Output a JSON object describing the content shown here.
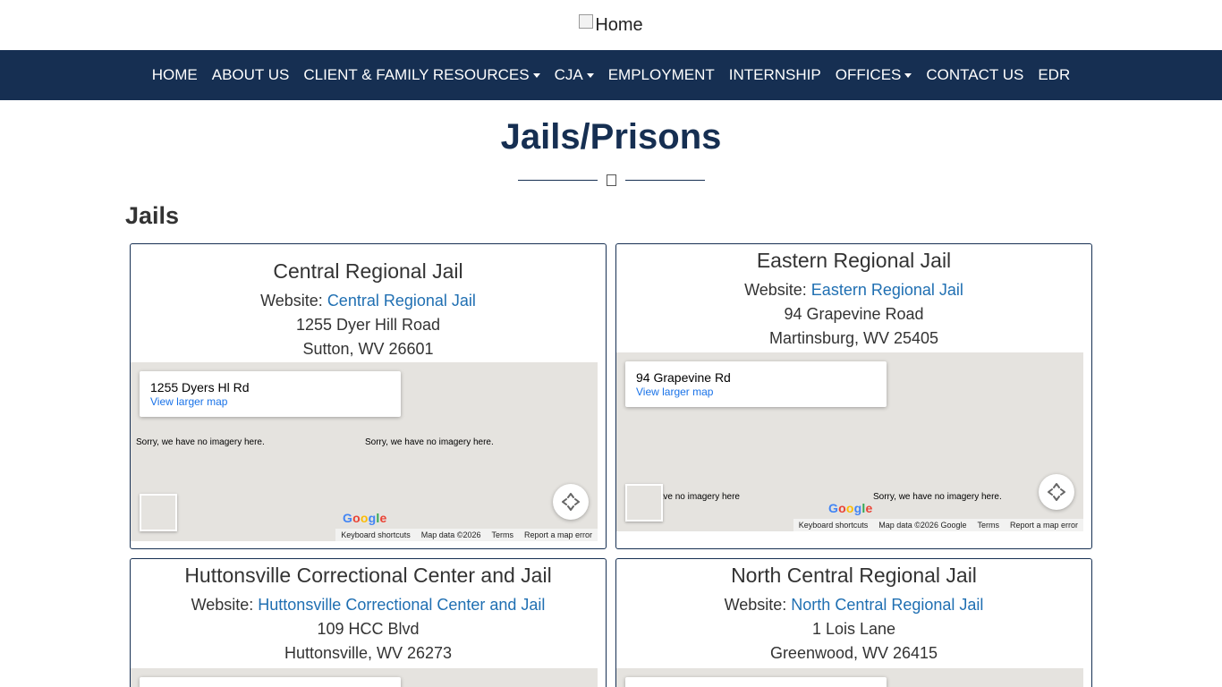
{
  "header": {
    "logo_alt": "Home"
  },
  "nav": {
    "items": [
      {
        "label": "HOME"
      },
      {
        "label": "ABOUT US"
      },
      {
        "label": "CLIENT & FAMILY RESOURCES"
      },
      {
        "label": "CJA"
      },
      {
        "label": "EMPLOYMENT"
      },
      {
        "label": "INTERNSHIP"
      },
      {
        "label": "OFFICES"
      },
      {
        "label": "CONTACT US"
      },
      {
        "label": "EDR"
      }
    ]
  },
  "page": {
    "title": "Jails/Prisons",
    "divider_icon": "square-glyph-icon"
  },
  "section": {
    "heading": "Jails"
  },
  "website_prefix": "Website:",
  "map_ui": {
    "view_larger": "View larger map",
    "no_imagery": "Sorry, we have no imagery here.",
    "keyboard": "Keyboard shortcuts",
    "terms": "Terms",
    "report": "Report a map error",
    "google": "Google"
  },
  "cards": [
    {
      "title": "Central Regional Jail",
      "website": "Central Regional Jail",
      "street": "1255 Dyer Hill Road",
      "city": "Sutton, WV 26601",
      "map_address": "1255 Dyers Hl Rd",
      "map_data": "Map data ©2026"
    },
    {
      "title": "Eastern Regional Jail",
      "website": "Eastern Regional Jail",
      "street": "94 Grapevine Road",
      "city": "Martinsburg, WV 25405",
      "map_address": "94 Grapevine Rd",
      "map_data": "Map data ©2026 Google"
    },
    {
      "title": "Huttonsville Correctional Center and Jail",
      "website": "Huttonsville Correctional Center and Jail",
      "street": "109 HCC Blvd",
      "city": "Huttonsville, WV 26273"
    },
    {
      "title": "North Central Regional Jail",
      "website": "North Central Regional Jail",
      "street": "1 Lois Lane",
      "city": "Greenwood, WV 26415"
    }
  ]
}
